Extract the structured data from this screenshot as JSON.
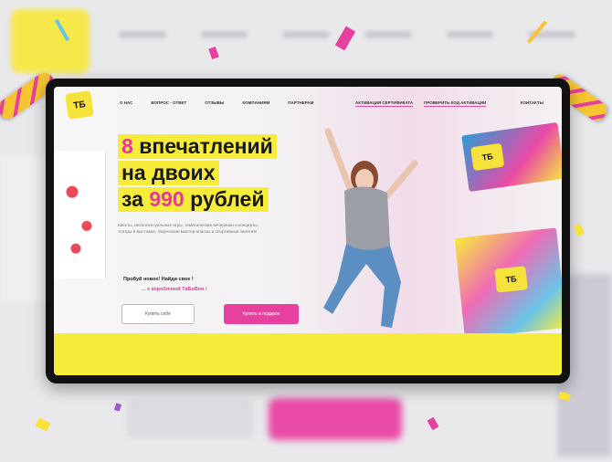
{
  "site": {
    "logo_text": "ТБ",
    "nav": [
      {
        "label": "О нас"
      },
      {
        "label": "Вопрос - ответ"
      },
      {
        "label": "Отзывы"
      },
      {
        "label": "Компаниям"
      },
      {
        "label": "Партнерам"
      }
    ],
    "nav_secondary": [
      {
        "label": "Активация сертификата"
      },
      {
        "label": "Проверить код активации"
      }
    ],
    "contacts_label": "Контакты"
  },
  "hero": {
    "line1_accent": "8",
    "line1_text": "впечатлений",
    "line2_text": "на двоих",
    "line3_prefix": "за",
    "line3_accent": "990",
    "line3_suffix": "рублей",
    "description": "Квесты, интеллектуальные игры, тематические вечеринки и концерты, театры и выставки, творческие мастер-классы и спортивные занятия!",
    "tagline1": "Пробуй новое! Найди свое !",
    "tagline2": "... с коробочкой ТаБоВон !",
    "buy_button": "Купить себе",
    "gift_button": "Купить в подарок"
  },
  "colors": {
    "accent_pink": "#e8409f",
    "highlight_yellow": "#f7ec3a",
    "monitor_frame": "#111111"
  }
}
